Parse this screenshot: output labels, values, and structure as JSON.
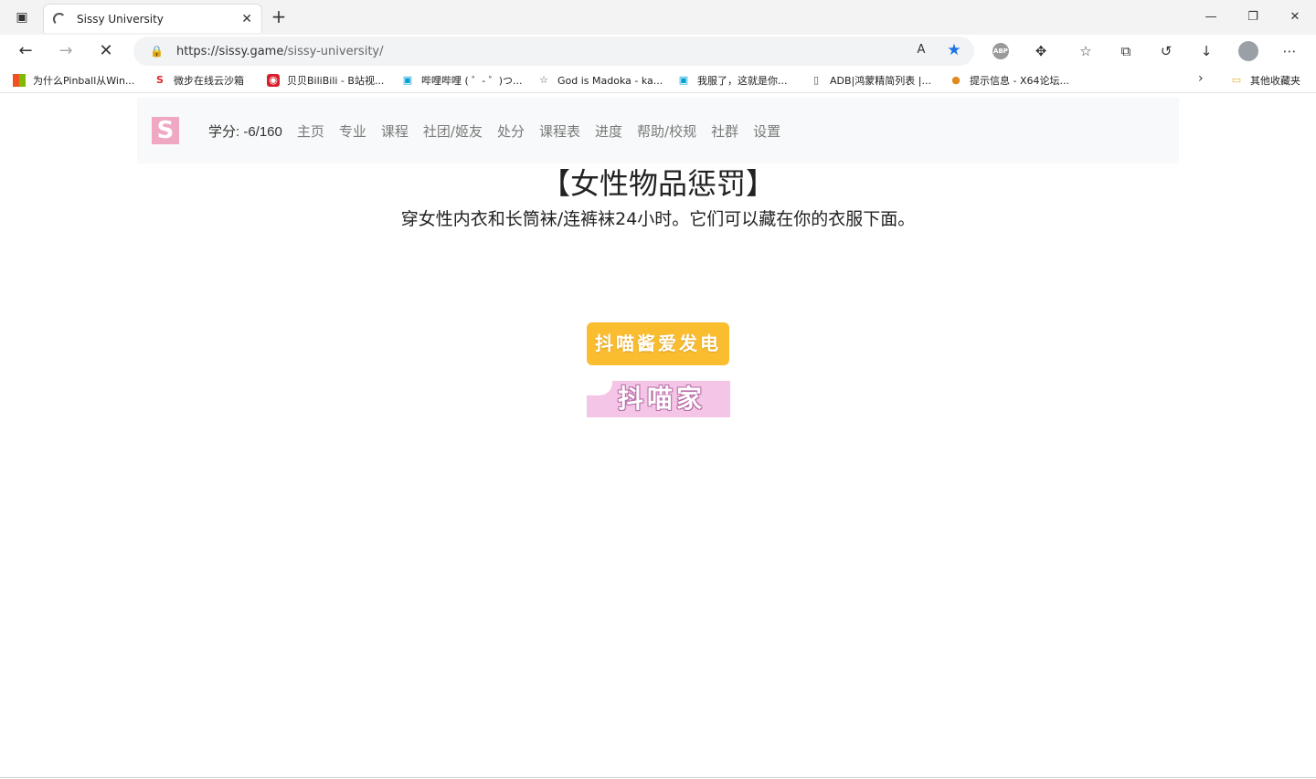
{
  "browser": {
    "tab_title": "Sissy University",
    "url_host": "https://sissy.game",
    "url_path": "/sissy-university/",
    "bookmarks": [
      {
        "label": "为什么Pinball从Win...",
        "icon": "windows-icon"
      },
      {
        "label": "微步在线云沙箱",
        "icon": "threatbook-icon"
      },
      {
        "label": "贝贝BiliBili - B站视...",
        "icon": "beibei-icon"
      },
      {
        "label": "哔哩哔哩 ( ゜- ゜)つ...",
        "icon": "bilibili-icon"
      },
      {
        "label": "God is Madoka - ka...",
        "icon": "star-icon"
      },
      {
        "label": "我服了，这就是你...",
        "icon": "bilibili-icon"
      },
      {
        "label": "ADB|鸿蒙精简列表 |...",
        "icon": "document-icon"
      },
      {
        "label": "提示信息 - X64论坛...",
        "icon": "x64-icon"
      }
    ],
    "other_bookmarks": "其他收藏夹"
  },
  "site": {
    "logo_letter": "S",
    "credit": "学分: -6/160",
    "nav": [
      "主页",
      "专业",
      "课程",
      "社团/姬友",
      "处分",
      "课程表",
      "进度",
      "帮助/校规",
      "社群",
      "设置"
    ]
  },
  "main": {
    "heading": "【女性物品惩罚】",
    "description": "穿女性内衣和长筒袜/连裤袜24小时。它们可以藏在你的衣服下面。",
    "donate_label": "抖喵酱爱发电",
    "home_label": "抖喵家"
  },
  "colors": {
    "logo": "#f0a7c4",
    "donate": "#fbbd30",
    "home": "#f4c5e6",
    "star": "#1a73e8"
  }
}
